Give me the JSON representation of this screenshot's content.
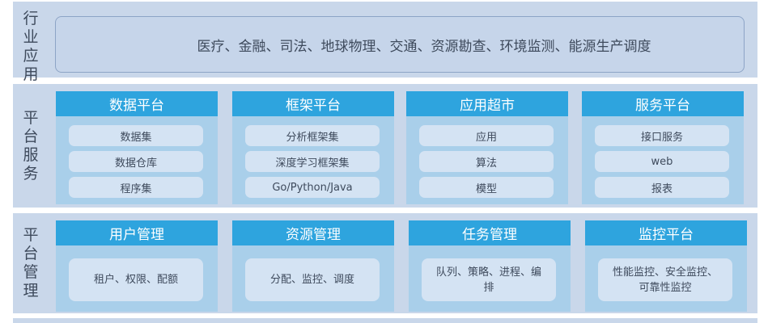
{
  "industry": {
    "label": [
      "行",
      "业",
      "应",
      "用"
    ],
    "text": "医疗、金融、司法、地球物理、交通、资源勘查、环境监测、能源生产调度"
  },
  "services": {
    "label": [
      "平",
      "台",
      "服",
      "务"
    ],
    "modules": [
      {
        "title": "数据平台",
        "items": [
          "数据集",
          "数据仓库",
          "程序集"
        ]
      },
      {
        "title": "框架平台",
        "items": [
          "分析框架集",
          "深度学习框架集",
          "Go/Python/Java"
        ]
      },
      {
        "title": "应用超市",
        "items": [
          "应用",
          "算法",
          "模型"
        ]
      },
      {
        "title": "服务平台",
        "items": [
          "接口服务",
          "web",
          "报表"
        ]
      }
    ]
  },
  "management": {
    "label": [
      "平",
      "台",
      "管",
      "理"
    ],
    "modules": [
      {
        "title": "用户管理",
        "text": "租户、权限、配额"
      },
      {
        "title": "资源管理",
        "text": "分配、监控、调度"
      },
      {
        "title": "任务管理",
        "text": "队列、策略、进程、编排"
      },
      {
        "title": "监控平台",
        "text": "性能监控、安全监控、可靠性监控"
      }
    ]
  }
}
